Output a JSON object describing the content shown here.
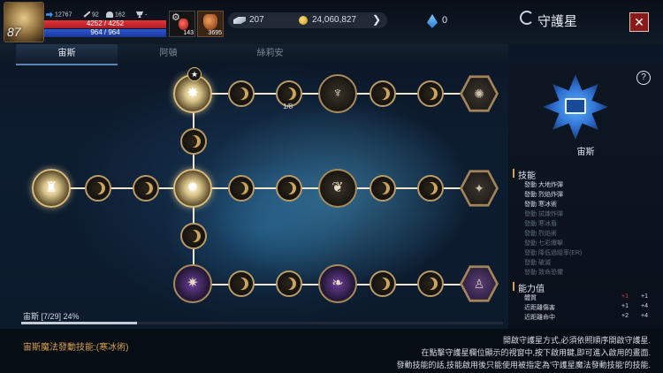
{
  "player": {
    "level": "87",
    "power": "12767",
    "attack": "92",
    "defense": "162",
    "rank": "-",
    "hp_text": "4252 / 4252",
    "mp_text": "964 / 964",
    "hp_fraction": 1.0,
    "mp_fraction": 1.0
  },
  "items": {
    "potion_count": "143",
    "item2_count": "3695"
  },
  "currency": {
    "gems": "207",
    "gold": "24,060,827",
    "crystal": "0"
  },
  "header": {
    "title": "守護星",
    "close_icon": "close-icon"
  },
  "tabs": [
    {
      "label": "宙斯",
      "active": true
    },
    {
      "label": "阿頓",
      "active": false
    },
    {
      "label": "絲莉安",
      "active": false
    }
  ],
  "tree": {
    "node_counter": "1/8"
  },
  "constellation": {
    "name": "宙斯",
    "help": "?"
  },
  "skills_section": {
    "title": "技能",
    "items": [
      {
        "text": "發動 大地炸彈",
        "active": true
      },
      {
        "text": "發動 烈焰炸彈",
        "active": true
      },
      {
        "text": "發動 寒冰術",
        "active": true
      },
      {
        "text": "發動 試煉炸彈",
        "active": false
      },
      {
        "text": "發動 寒冰盾",
        "active": false
      },
      {
        "text": "發動 烈焰術",
        "active": false
      },
      {
        "text": "發動 七彩爆擊",
        "active": false
      },
      {
        "text": "發動 降低過級率(ER)",
        "active": false
      },
      {
        "text": "發動 破滅",
        "active": false
      },
      {
        "text": "發動 致命恐懼",
        "active": false
      }
    ]
  },
  "ability_section": {
    "title": "能力值",
    "rows": [
      {
        "label": "體質",
        "cur": "+1",
        "next": "+1",
        "cur_color": "#e04040"
      },
      {
        "label": "近距離傷害",
        "cur": "+1",
        "next": "+4",
        "cur_color": "#d6dbe2"
      },
      {
        "label": "近距離命中",
        "cur": "+2",
        "next": "+4",
        "cur_color": "#d6dbe2"
      }
    ]
  },
  "progress": {
    "label": "宙斯 [7/29] 24%",
    "fraction": 0.24
  },
  "footer": {
    "left_text": "宙斯魔法發動技能:(寒冰術)",
    "right_lines": [
      "開啟守護星方式,必須依照順序開啟守護星.",
      "在點擊守護星欄位顯示的視窗中,按下啟用鍵,即可進入啟用的畫面.",
      "發動技能的話,技能啟用後只能使用被指定為'守護星魔法發動技能'的技能."
    ]
  },
  "colors": {
    "accent": "#d9a04a",
    "hp": "#e8333a",
    "mp": "#2d55d8"
  }
}
